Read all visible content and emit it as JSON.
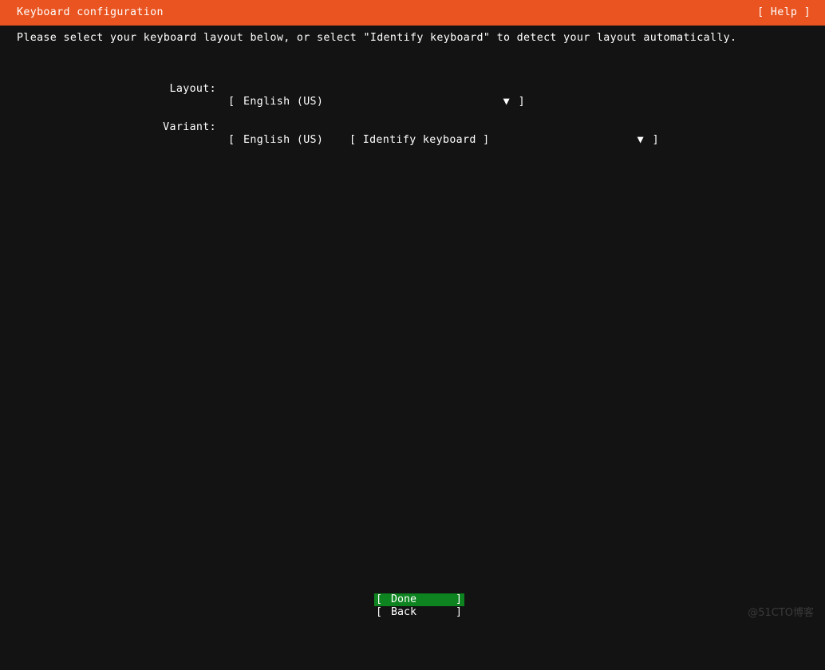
{
  "header": {
    "title": "Keyboard configuration",
    "help_label": "[ Help ]",
    "background_color": "#e95420",
    "text_color": "#ffffff"
  },
  "screen": {
    "background_color": "#131313",
    "text_color": "#ffffff",
    "instruction": "Please select your keyboard layout below, or select \"Identify keyboard\" to detect your layout automatically."
  },
  "form": {
    "layout": {
      "label": "Layout:",
      "bracket_open": "[",
      "value": "English (US)",
      "caret": "▼",
      "bracket_close": "]"
    },
    "variant": {
      "label": "Variant:",
      "bracket_open": "[",
      "value": "English (US)",
      "caret": "▼",
      "bracket_close": "]"
    },
    "identify_button": "[ Identify keyboard ]"
  },
  "footer": {
    "done": {
      "bracket_open": "[",
      "label": "Done",
      "bracket_close": "]",
      "selected": true,
      "highlight_color": "#0e8420"
    },
    "back": {
      "bracket_open": "[",
      "label": "Back",
      "bracket_close": "]",
      "selected": false
    }
  },
  "watermark": {
    "text": "@51CTO博客",
    "color": "#3a3a3a"
  }
}
